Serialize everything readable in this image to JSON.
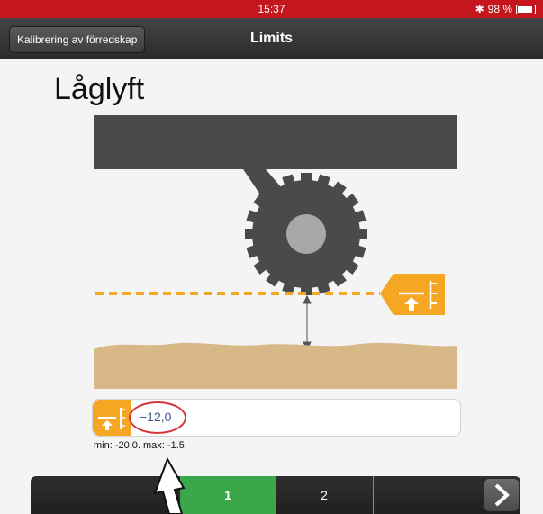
{
  "status_bar": {
    "time": "15:37",
    "battery": "98 %"
  },
  "nav": {
    "back_label": "Kalibrering av förredskap",
    "title": "Limits"
  },
  "page": {
    "title": "Låglyft"
  },
  "input": {
    "value": "−12,0",
    "range_note": "min: -20.0. max: -1.5."
  },
  "steps": {
    "step1": "1",
    "step2": "2"
  },
  "colors": {
    "accent_orange": "#f5a623",
    "active_green": "#3aa84a",
    "status_red": "#c4161c",
    "soil": "#d8b887"
  },
  "icons": {
    "height_limit": "height-limit-icon",
    "next": "chevron-right-icon",
    "bluetooth": "bluetooth-icon",
    "battery": "battery-icon"
  }
}
